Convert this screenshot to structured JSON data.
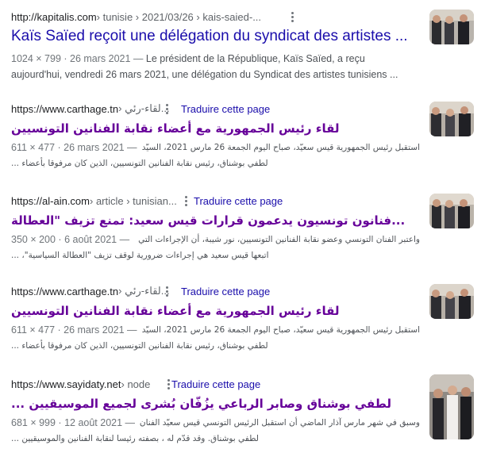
{
  "results": [
    {
      "host": "http://kapitalis.com",
      "path": " › tunisie › 2021/03/26 › kais-saied-...",
      "translate": "",
      "title": "Kaïs Saïed reçoit une délégation du syndicat des artistes ...",
      "meta": "1024 × 799 · 26 mars 2021 —",
      "snippet_1": " Le président de la République, Kaïs Saïed, a reçu",
      "snippet_2": "aujourd'hui, vendredi 26 mars 2021, une délégation du Syndicat des artistes tunisiens ..."
    },
    {
      "host": "https://www.carthage.tn",
      "path": " › لقاء-رئي...",
      "translate": "Traduire cette page",
      "title": "لقاء رئيس الجمهورية مع أعضاء نقابة الفنانين التونسيين",
      "meta": "611 × 477 · 26 mars 2021 —",
      "snippet_1": "استقبل رئيس الجمهورية قيس سعيّد، صباح اليوم الجمعة 26 مارس 2021، السيّد",
      "snippet_2": "لطفي بوشناق، رئيس نقابة الفنانين التونسيين، الذين كان مرفوقا بأعضاء ..."
    },
    {
      "host": "https://al-ain.com",
      "path": " › article › tunisian...",
      "translate": "Traduire cette page",
      "title": "...فنانون تونسيون يدعمون قرارات قيس سعيد: تمنع تزيف \"العطالة",
      "meta": "350 × 200 · 6 août 2021 —",
      "snippet_1": "واعتبر الفنان التونسي وعضو نقابة الفنانين التونسيين، نور شيبة، أن الإجراءات التي",
      "snippet_2": "اتبعها قيس سعيد هي إجراءات ضرورية لوقف تزيف \"العطالة السياسية\"، ..."
    },
    {
      "host": "https://www.carthage.tn",
      "path": " › لقاء-رئي...",
      "translate": "Traduire cette page",
      "title": "لقاء رئيس الجمهورية مع أعضاء نقابة الفنانين التونسيين",
      "meta": "611 × 477 · 26 mars 2021 —",
      "snippet_1": "استقبل رئيس الجمهورية قيس سعيّد، صباح اليوم الجمعة 26 مارس 2021، السيّد",
      "snippet_2": "لطفي بوشناق، رئيس نقابة الفنانين التونسيين، الذين كان مرفوقا بأعضاء ..."
    },
    {
      "host": "https://www.sayidaty.net",
      "path": " › node",
      "translate": "Traduire cette page",
      "title": "لطفي بوشناق وصابر الرباعي يزُفّان بُشرى لجميع الموسيقيين ...",
      "meta": "681 × 999 · 12 août 2021 —",
      "snippet_1": "وسبق في شهر مارس آذار الماضي أن استقبل الرئيس التونسي قيس سعيّد الفنان",
      "snippet_2": "لطفي بوشناق. وقد قدّم له ، بصفته رئيسا لنقابة الفنانين والموسيقيين ..."
    }
  ],
  "colors": {
    "link_unvisited": "#1a0dab",
    "link_visited": "#660099",
    "snippet": "#4d5156",
    "meta": "#70757a"
  },
  "icons": {
    "more": "three-dots-vertical-icon"
  }
}
